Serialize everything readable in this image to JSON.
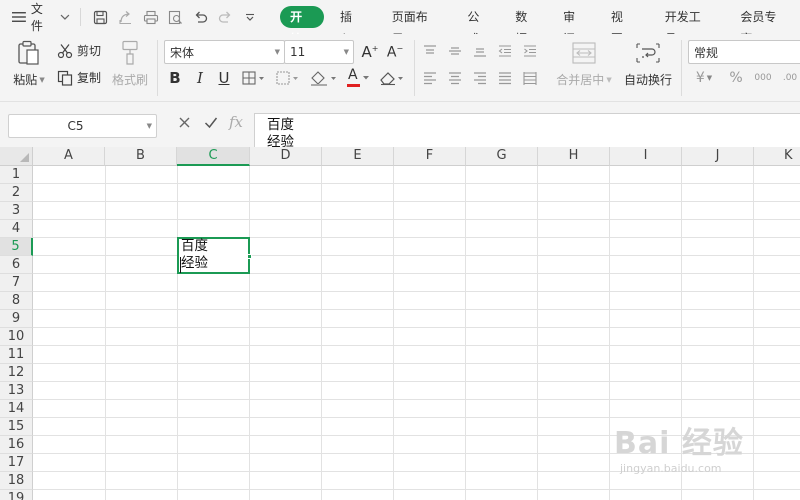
{
  "menubar": {
    "file_label": "文件",
    "tabs": [
      {
        "label": "开始",
        "active": true
      },
      {
        "label": "插入"
      },
      {
        "label": "页面布局"
      },
      {
        "label": "公式"
      },
      {
        "label": "数据"
      },
      {
        "label": "审阅"
      },
      {
        "label": "视图"
      },
      {
        "label": "开发工具"
      },
      {
        "label": "会员专享"
      }
    ]
  },
  "ribbon": {
    "paste": "粘贴",
    "cut": "剪切",
    "copy": "复制",
    "format_painter": "格式刷",
    "font_name": "宋体",
    "font_size": "11",
    "merge_center": "合并居中",
    "wrap_text": "自动换行",
    "number_format": "常规",
    "currency_symbol": "¥",
    "percent_symbol": "%",
    "thousands_symbol": "000"
  },
  "formula_bar": {
    "cell_ref": "C5",
    "fx_label": "fx",
    "content_line1": "百度",
    "content_line2": "经验"
  },
  "sheet": {
    "columns": [
      "A",
      "B",
      "C",
      "D",
      "E",
      "F",
      "G",
      "H",
      "I",
      "J",
      "K"
    ],
    "rows": [
      "1",
      "2",
      "3",
      "4",
      "5",
      "6",
      "7",
      "8",
      "9",
      "10",
      "11",
      "12",
      "13",
      "14",
      "15",
      "16",
      "17",
      "18",
      "19"
    ],
    "selected_column": "C",
    "selected_row": "5",
    "active_cell_line1": "百度",
    "active_cell_line2": "经验"
  },
  "watermark": {
    "logo_text": "Bai 经验",
    "url": "jingyan.baidu.com"
  },
  "colors": {
    "accent": "#1b9a54",
    "font_color_bar": "#e02020"
  }
}
